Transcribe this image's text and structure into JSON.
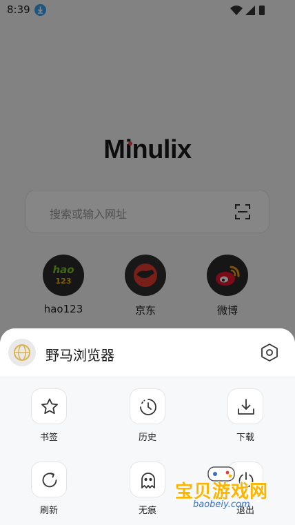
{
  "status_bar": {
    "time": "8:39",
    "download_icon": "download-arrow-icon"
  },
  "browser": {
    "logo": "Minulix",
    "search_placeholder": "搜索或输入网址",
    "shortcuts": [
      {
        "label": "hao123",
        "icon_text": "hao\n123",
        "color": "#2b2b2b"
      },
      {
        "label": "京东",
        "icon": "jd-dog-icon",
        "color": "#e43c30"
      },
      {
        "label": "微博",
        "icon": "weibo-icon",
        "color": "#e6162d"
      }
    ]
  },
  "sheet": {
    "title": "野马浏览器",
    "items": [
      {
        "label": "书签",
        "icon": "star-icon"
      },
      {
        "label": "历史",
        "icon": "history-clock-icon"
      },
      {
        "label": "下载",
        "icon": "download-tray-icon"
      },
      {
        "label": "刷新",
        "icon": "refresh-icon"
      },
      {
        "label": "无痕",
        "icon": "ghost-icon"
      },
      {
        "label": "退出",
        "icon": "power-icon"
      }
    ]
  },
  "watermark": {
    "text": "宝贝游戏网",
    "url": "baobeiy.com"
  },
  "colors": {
    "accent_blue": "#3aa0f0",
    "logo_dot": "#f04040",
    "watermark_orange": "#ffb400"
  }
}
